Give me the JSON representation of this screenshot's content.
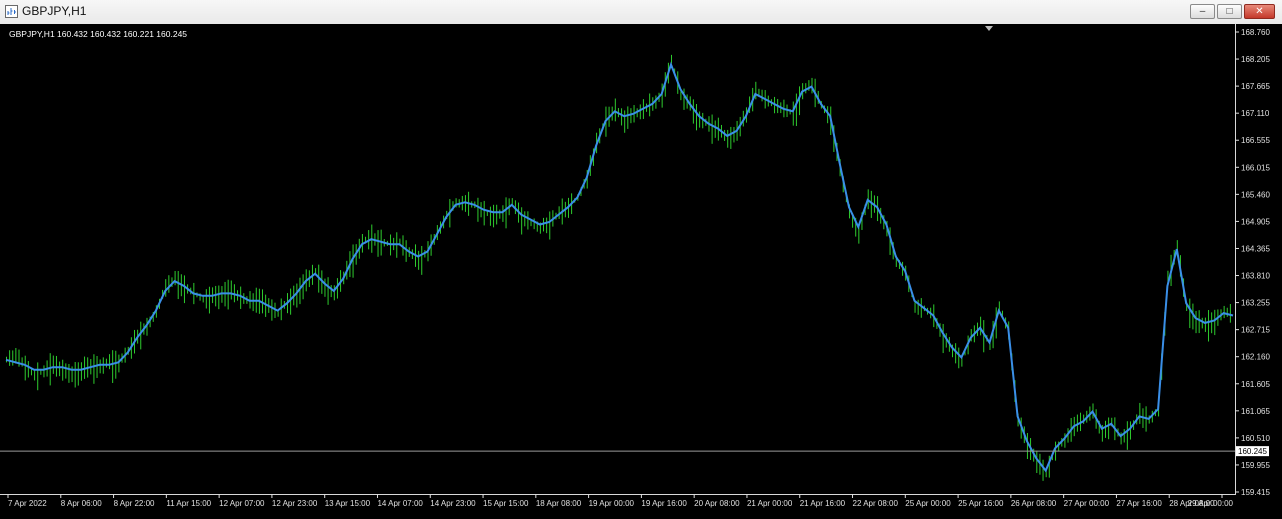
{
  "window": {
    "title": "GBPJPY,H1",
    "buttons": {
      "minimize": "–",
      "maximize": "□",
      "close": "✕"
    }
  },
  "chart_data": {
    "type": "line",
    "header": "GBPJPY,H1  160.432 160.432 160.221 160.245",
    "price_axis_ticks": [
      "168.760",
      "168.205",
      "167.665",
      "167.110",
      "166.555",
      "166.015",
      "165.460",
      "164.905",
      "164.365",
      "163.810",
      "163.255",
      "162.715",
      "162.160",
      "161.605",
      "161.065",
      "160.510",
      "159.955",
      "159.415"
    ],
    "time_axis_ticks": [
      "7 Apr 2022",
      "8 Apr 06:00",
      "8 Apr 22:00",
      "11 Apr 15:00",
      "12 Apr 07:00",
      "12 Apr 23:00",
      "13 Apr 15:00",
      "14 Apr 07:00",
      "14 Apr 23:00",
      "15 Apr 15:00",
      "18 Apr 08:00",
      "19 Apr 00:00",
      "19 Apr 16:00",
      "20 Apr 08:00",
      "21 Apr 00:00",
      "21 Apr 16:00",
      "22 Apr 08:00",
      "25 Apr 00:00",
      "25 Apr 16:00",
      "26 Apr 08:00",
      "27 Apr 00:00",
      "27 Apr 16:00",
      "28 Apr 08:00",
      "29 Apr 00:00"
    ],
    "ylim": [
      159.415,
      168.76
    ],
    "current_price": 160.245,
    "colors": {
      "background": "#000000",
      "bars": "#2ecc2e",
      "ma_line": "#3a8fe8",
      "axis": "#e0e0e0",
      "price_line": "#9a9a9a"
    },
    "series": [
      {
        "type": "ohlc_bars",
        "values": [
          162.1,
          162.2,
          162.0,
          161.8,
          161.9,
          162.05,
          161.9,
          161.8,
          161.9,
          161.95,
          162.0,
          162.05,
          162.05,
          162.3,
          162.6,
          162.8,
          163.1,
          163.6,
          163.75,
          163.6,
          163.45,
          163.35,
          163.4,
          163.45,
          163.5,
          163.4,
          163.3,
          163.35,
          163.2,
          163.05,
          163.3,
          163.45,
          163.7,
          163.9,
          163.6,
          163.45,
          163.8,
          164.2,
          164.5,
          164.6,
          164.5,
          164.45,
          164.5,
          164.3,
          164.15,
          164.3,
          164.7,
          165.05,
          165.3,
          165.3,
          165.25,
          165.1,
          165.05,
          165.1,
          165.3,
          165.0,
          164.9,
          164.8,
          164.9,
          165.1,
          165.2,
          165.4,
          165.8,
          166.5,
          167.0,
          167.2,
          167.0,
          167.1,
          167.2,
          167.3,
          167.5,
          168.2,
          167.5,
          167.3,
          167.0,
          166.9,
          166.8,
          166.6,
          166.75,
          167.1,
          167.6,
          167.4,
          167.3,
          167.2,
          167.1,
          167.6,
          167.7,
          167.3,
          167.0,
          166.0,
          165.1,
          164.7,
          165.4,
          165.2,
          164.8,
          164.1,
          163.9,
          163.2,
          163.15,
          163.0,
          162.6,
          162.3,
          162.1,
          162.6,
          162.8,
          162.4,
          163.2,
          162.7,
          160.9,
          160.4,
          160.05,
          159.8,
          160.3,
          160.5,
          160.8,
          160.9,
          161.1,
          160.6,
          160.85,
          160.5,
          160.7,
          161.0,
          160.9,
          161.1,
          163.8,
          164.4,
          163.2,
          162.9,
          162.85,
          162.9,
          163.1,
          163.0
        ]
      },
      {
        "type": "moving_average",
        "values": [
          162.1,
          162.05,
          162.0,
          161.9,
          161.9,
          161.95,
          161.95,
          161.9,
          161.9,
          161.95,
          162.0,
          162.0,
          162.05,
          162.25,
          162.55,
          162.8,
          163.1,
          163.5,
          163.7,
          163.6,
          163.45,
          163.4,
          163.4,
          163.45,
          163.45,
          163.4,
          163.3,
          163.3,
          163.2,
          163.1,
          163.25,
          163.45,
          163.7,
          163.85,
          163.65,
          163.5,
          163.75,
          164.15,
          164.45,
          164.55,
          164.5,
          164.45,
          164.45,
          164.3,
          164.2,
          164.3,
          164.65,
          165.0,
          165.25,
          165.3,
          165.25,
          165.15,
          165.1,
          165.1,
          165.25,
          165.05,
          164.95,
          164.85,
          164.9,
          165.05,
          165.2,
          165.4,
          165.8,
          166.45,
          166.95,
          167.15,
          167.05,
          167.1,
          167.2,
          167.3,
          167.5,
          168.1,
          167.6,
          167.3,
          167.05,
          166.9,
          166.8,
          166.65,
          166.75,
          167.05,
          167.5,
          167.4,
          167.3,
          167.2,
          167.15,
          167.55,
          167.65,
          167.3,
          167.05,
          166.1,
          165.2,
          164.8,
          165.35,
          165.2,
          164.85,
          164.2,
          163.9,
          163.3,
          163.15,
          163.0,
          162.65,
          162.35,
          162.15,
          162.55,
          162.75,
          162.45,
          163.1,
          162.75,
          160.95,
          160.45,
          160.1,
          159.85,
          160.3,
          160.5,
          160.75,
          160.85,
          161.05,
          160.7,
          160.8,
          160.55,
          160.7,
          160.95,
          160.9,
          161.1,
          163.6,
          164.35,
          163.25,
          162.95,
          162.85,
          162.9,
          163.05,
          163.0
        ]
      }
    ]
  }
}
